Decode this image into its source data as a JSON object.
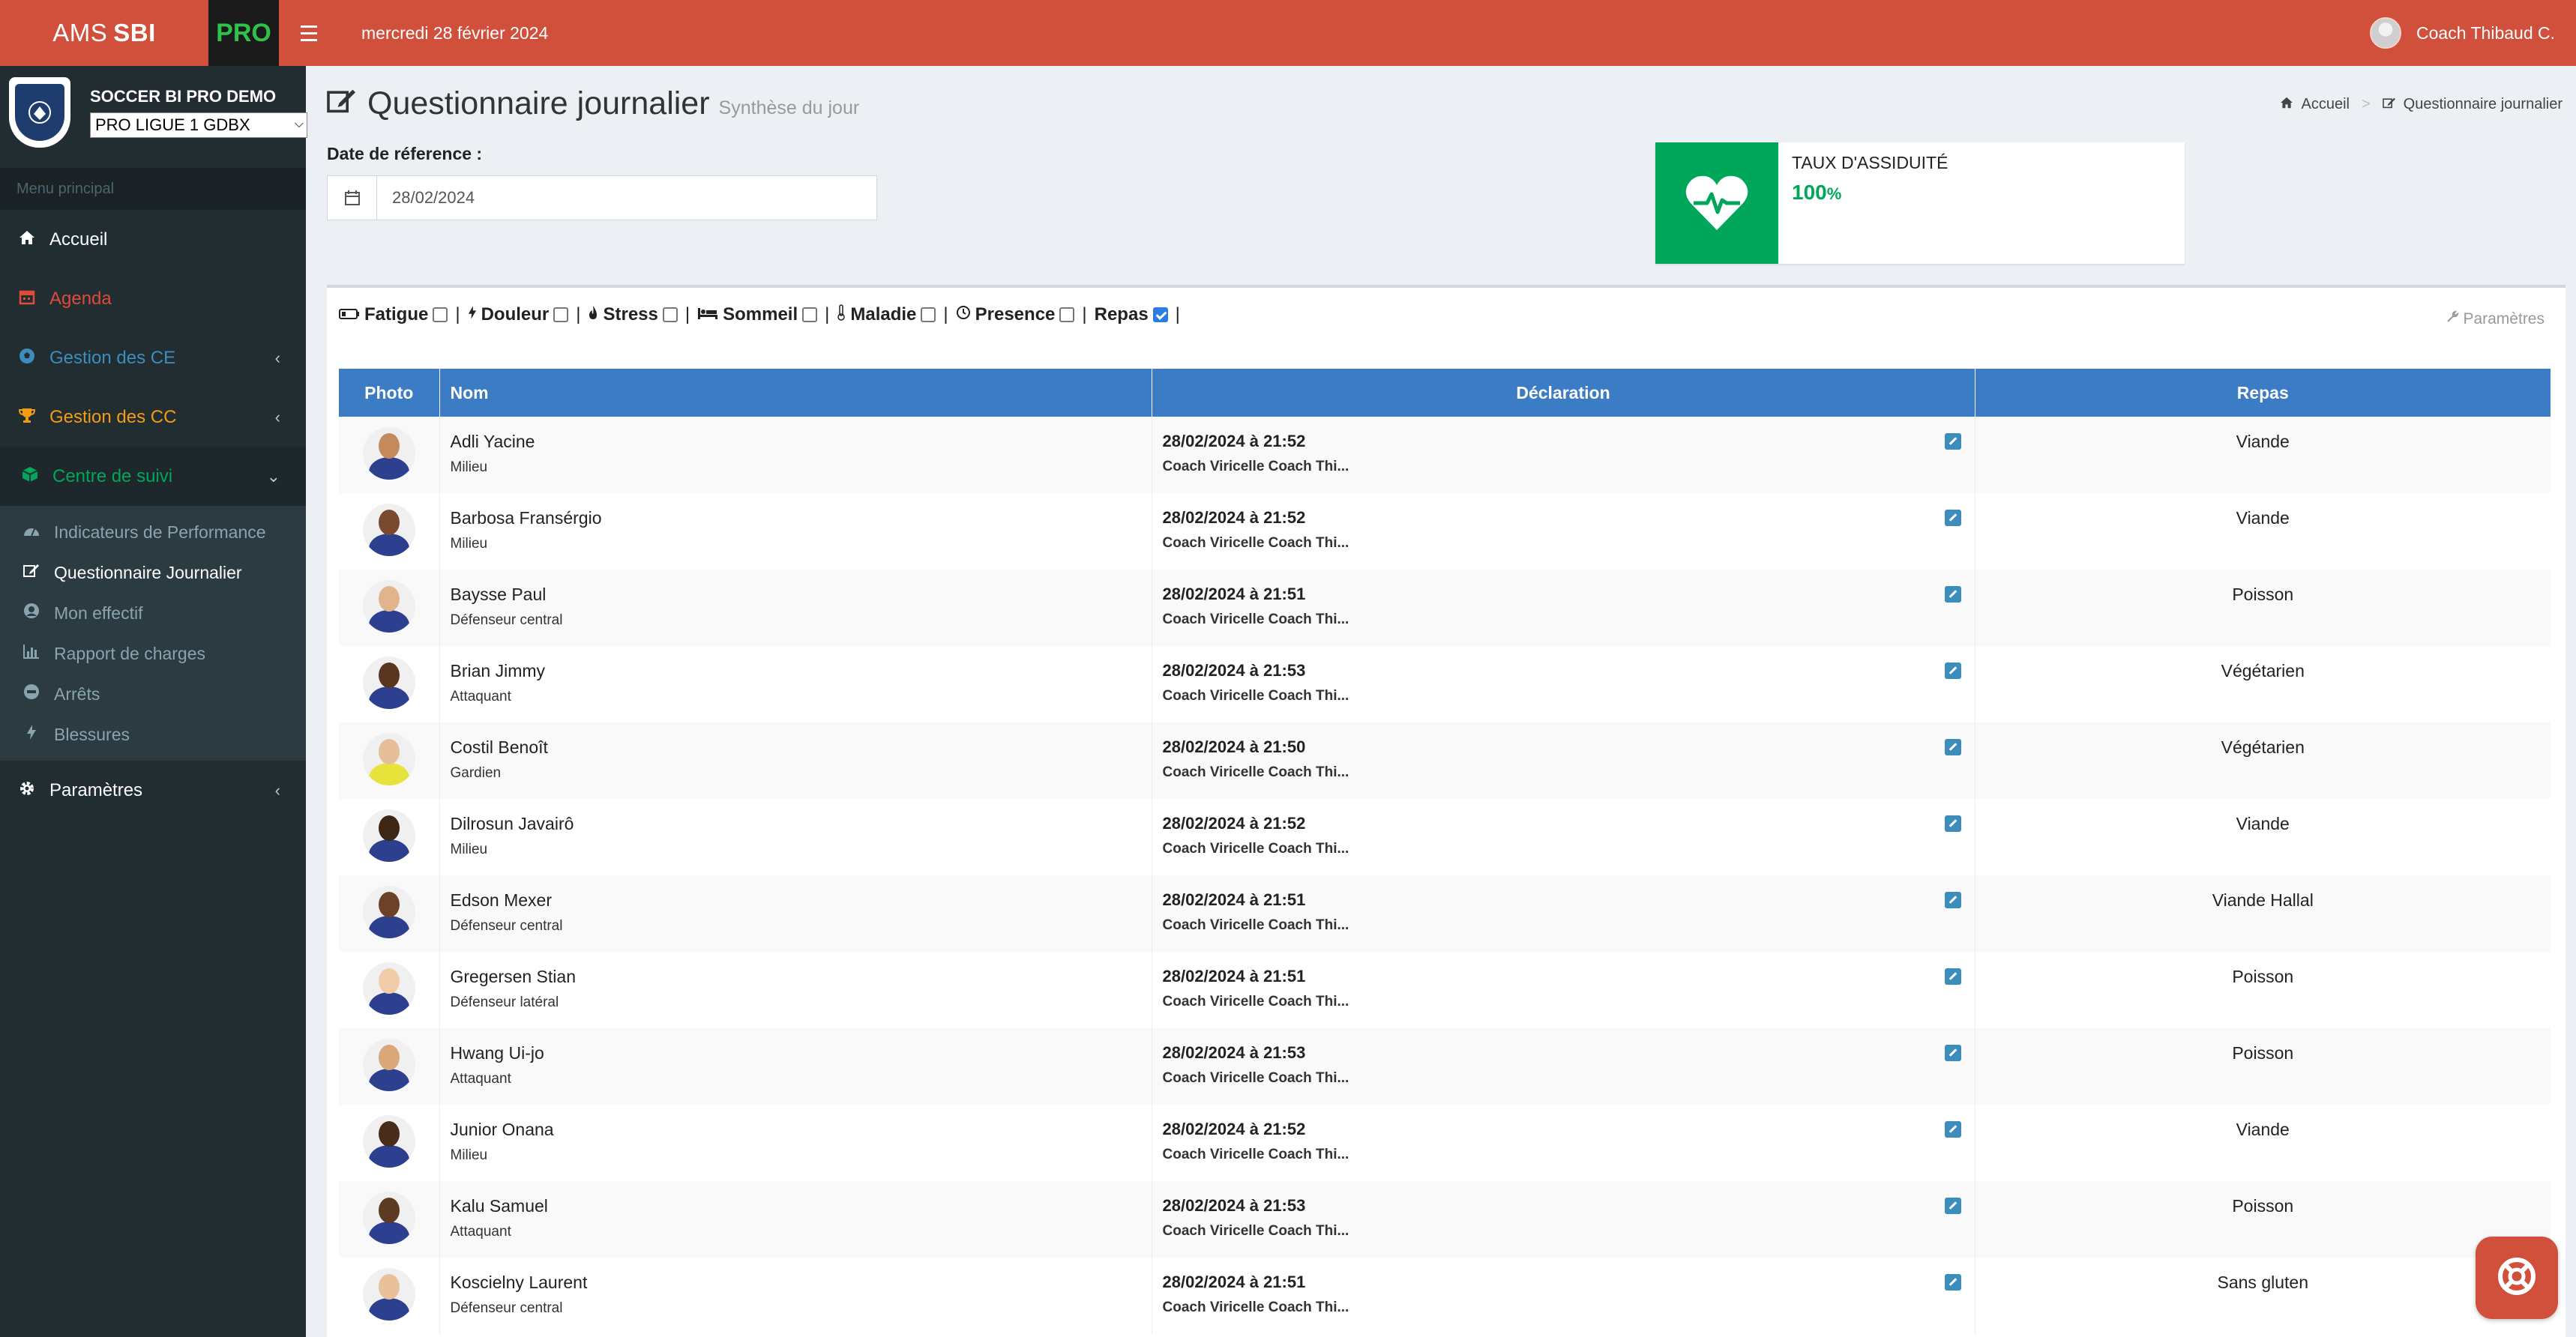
{
  "topbar": {
    "logo_text": "AMS",
    "logo_bold": "SBI",
    "logo_pro": "PRO",
    "date": "mercredi 28 février 2024",
    "user_name": "Coach Thibaud C."
  },
  "sidebar": {
    "club_name": "SOCCER BI PRO DEMO",
    "club_select": "PRO LIGUE 1 GDBX",
    "menu_header": "Menu principal",
    "items": [
      {
        "label": "Accueil",
        "icon": "home-icon"
      },
      {
        "label": "Agenda",
        "icon": "calendar-icon",
        "color": "#dd4b39"
      },
      {
        "label": "Gestion des CE",
        "icon": "soccer-ball-icon",
        "color": "#3c8dbc"
      },
      {
        "label": "Gestion des CC",
        "icon": "trophy-icon",
        "color": "#f39c12"
      },
      {
        "label": "Centre de suivi",
        "icon": "cube-icon",
        "color": "#00a65a"
      },
      {
        "label": "Paramètres",
        "icon": "gear-icon"
      }
    ],
    "subitems": [
      {
        "label": "Indicateurs de Performance",
        "icon": "dashboard-icon"
      },
      {
        "label": "Questionnaire Journalier",
        "icon": "edit-icon"
      },
      {
        "label": "Mon effectif",
        "icon": "user-circle-icon"
      },
      {
        "label": "Rapport de charges",
        "icon": "bar-chart-icon"
      },
      {
        "label": "Arrêts",
        "icon": "minus-circle-icon"
      },
      {
        "label": "Blessures",
        "icon": "bolt-icon"
      }
    ]
  },
  "page": {
    "title": "Questionnaire journalier",
    "subtitle": "Synthèse du jour",
    "breadcrumb": [
      "Accueil",
      "Questionnaire journalier"
    ],
    "date_label": "Date de réference :",
    "date_value": "28/02/2024"
  },
  "kpi": {
    "label": "TAUX D'ASSIDUITÉ",
    "value": "100",
    "unit": "%",
    "color": "#00a65a"
  },
  "filters": {
    "items": [
      {
        "label": "Fatigue",
        "icon": "battery-icon",
        "checked": false
      },
      {
        "label": "Douleur",
        "icon": "bolt-icon",
        "checked": false
      },
      {
        "label": "Stress",
        "icon": "fire-icon",
        "checked": false
      },
      {
        "label": "Sommeil",
        "icon": "bed-icon",
        "checked": false
      },
      {
        "label": "Maladie",
        "icon": "thermometer-icon",
        "checked": false
      },
      {
        "label": "Presence",
        "icon": "clock-icon",
        "checked": false
      },
      {
        "label": "Repas",
        "icon": "",
        "checked": true
      }
    ],
    "params_label": "Paramètres"
  },
  "table": {
    "headers": [
      "Photo",
      "Nom",
      "Déclaration",
      "Repas"
    ],
    "rows": [
      {
        "name": "Adli Yacine",
        "position": "Milieu",
        "date": "28/02/2024 à 21:52",
        "coach": "Coach Viricelle Coach Thi...",
        "repas": "Viande"
      },
      {
        "name": "Barbosa Fransérgio",
        "position": "Milieu",
        "date": "28/02/2024 à 21:52",
        "coach": "Coach Viricelle Coach Thi...",
        "repas": "Viande"
      },
      {
        "name": "Baysse Paul",
        "position": "Défenseur central",
        "date": "28/02/2024 à 21:51",
        "coach": "Coach Viricelle Coach Thi...",
        "repas": "Poisson"
      },
      {
        "name": "Brian Jimmy",
        "position": "Attaquant",
        "date": "28/02/2024 à 21:53",
        "coach": "Coach Viricelle Coach Thi...",
        "repas": "Végétarien"
      },
      {
        "name": "Costil Benoît",
        "position": "Gardien",
        "date": "28/02/2024 à 21:50",
        "coach": "Coach Viricelle Coach Thi...",
        "repas": "Végétarien"
      },
      {
        "name": "Dilrosun Javairô",
        "position": "Milieu",
        "date": "28/02/2024 à 21:52",
        "coach": "Coach Viricelle Coach Thi...",
        "repas": "Viande"
      },
      {
        "name": "Edson Mexer",
        "position": "Défenseur central",
        "date": "28/02/2024 à 21:51",
        "coach": "Coach Viricelle Coach Thi...",
        "repas": "Viande Hallal"
      },
      {
        "name": "Gregersen Stian",
        "position": "Défenseur latéral",
        "date": "28/02/2024 à 21:51",
        "coach": "Coach Viricelle Coach Thi...",
        "repas": "Poisson"
      },
      {
        "name": "Hwang Ui-jo",
        "position": "Attaquant",
        "date": "28/02/2024 à 21:53",
        "coach": "Coach Viricelle Coach Thi...",
        "repas": "Poisson"
      },
      {
        "name": "Junior Onana",
        "position": "Milieu",
        "date": "28/02/2024 à 21:52",
        "coach": "Coach Viricelle Coach Thi...",
        "repas": "Viande"
      },
      {
        "name": "Kalu Samuel",
        "position": "Attaquant",
        "date": "28/02/2024 à 21:53",
        "coach": "Coach Viricelle Coach Thi...",
        "repas": "Poisson"
      },
      {
        "name": "Koscielny Laurent",
        "position": "Défenseur central",
        "date": "28/02/2024 à 21:51",
        "coach": "Coach Viricelle Coach Thi...",
        "repas": "Sans gluten"
      }
    ]
  },
  "colors": {
    "topbar": "#d1503c",
    "sidebar": "#222d32",
    "table_header": "#3c7cc4",
    "accent_green": "#00a65a"
  }
}
